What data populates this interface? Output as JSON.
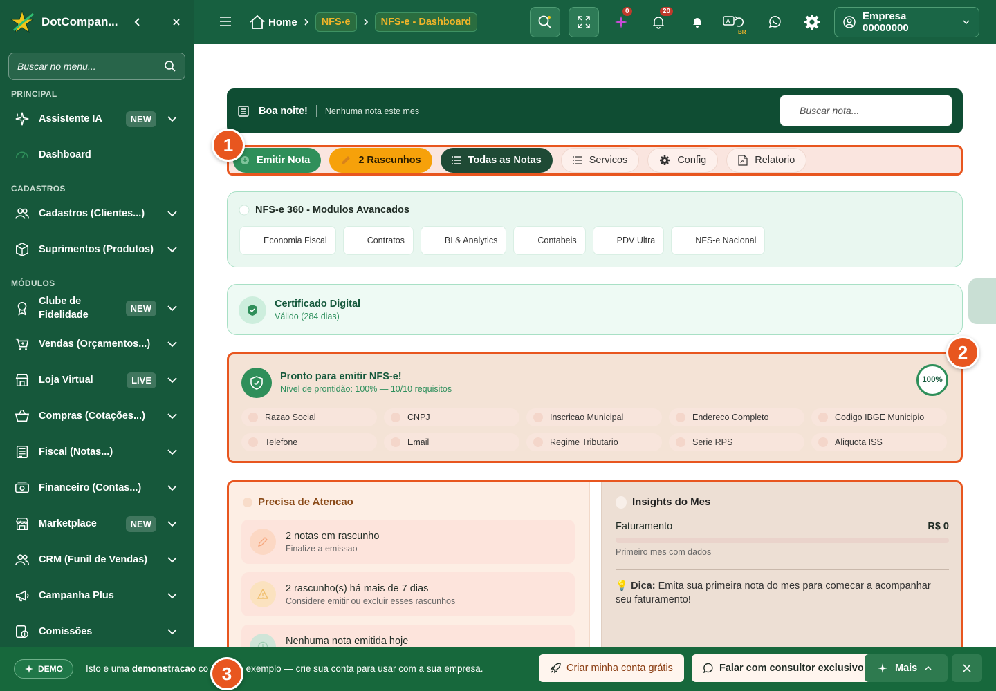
{
  "sidebar": {
    "brand": "DotCompan...",
    "search_placeholder": "Buscar no menu...",
    "sections": {
      "principal": "PRINCIPAL",
      "cadastros": "CADASTROS",
      "modulos": "MÓDULOS"
    },
    "items": [
      {
        "label": "Assistente IA",
        "badge": "NEW",
        "icon": "sparkle-icon"
      },
      {
        "label": "Dashboard",
        "badge": "",
        "icon": "gauge-icon"
      },
      {
        "label": "Cadastros (Clientes...)",
        "badge": "",
        "icon": "users-icon"
      },
      {
        "label": "Suprimentos (Produtos)",
        "badge": "",
        "icon": "box-icon"
      },
      {
        "label": "Clube de Fidelidade",
        "badge": "NEW",
        "icon": "medal-icon"
      },
      {
        "label": "Vendas (Orçamentos...)",
        "badge": "",
        "icon": "cart-icon"
      },
      {
        "label": "Loja Virtual",
        "badge": "LIVE",
        "icon": "store-icon"
      },
      {
        "label": "Compras (Cotações...)",
        "badge": "",
        "icon": "basket-icon"
      },
      {
        "label": "Fiscal (Notas...)",
        "badge": "",
        "icon": "receipt-icon"
      },
      {
        "label": "Financeiro (Contas...)",
        "badge": "",
        "icon": "money-icon"
      },
      {
        "label": "Marketplace",
        "badge": "NEW",
        "icon": "shop-icon"
      },
      {
        "label": "CRM (Funil de Vendas)",
        "badge": "",
        "icon": "users-icon"
      },
      {
        "label": "Campanha Plus",
        "badge": "",
        "icon": "megaphone-icon"
      },
      {
        "label": "Comissões",
        "badge": "",
        "icon": "coins-icon"
      }
    ]
  },
  "topbar": {
    "breadcrumb": {
      "home": "Home",
      "nfse": "NFS-e",
      "dashboard": "NFS-e - Dashboard"
    },
    "ai_count": "0",
    "notif_count": "20",
    "lang": "BR",
    "empresa": "Empresa 00000000"
  },
  "hero": {
    "greeting": "Boa noite!",
    "subtitle": "Nenhuma nota este mes",
    "search_placeholder": "Buscar nota..."
  },
  "actions": [
    {
      "label": "Emitir Nota",
      "style": "green"
    },
    {
      "label": "2 Rascunhos",
      "style": "orange"
    },
    {
      "label": "Todas as Notas",
      "style": "dark"
    },
    {
      "label": "Servicos",
      "style": "light"
    },
    {
      "label": "Config",
      "style": "light"
    },
    {
      "label": "Relatorio",
      "style": "light"
    }
  ],
  "modules": {
    "title": "NFS-e 360 - Modulos Avancados",
    "items": [
      "Economia Fiscal",
      "Contratos",
      "BI & Analytics",
      "Contabeis",
      "PDV Ultra",
      "NFS-e Nacional"
    ]
  },
  "certificate": {
    "title": "Certificado Digital",
    "status": "Válido (284 dias)"
  },
  "readiness": {
    "title": "Pronto para emitir NFS-e!",
    "subtitle": "Nível de prontidão: 100% — 10/10 requisitos",
    "percent_label": "100%",
    "percent": 100,
    "requirements": [
      "Razao Social",
      "CNPJ",
      "Inscricao Municipal",
      "Endereco Completo",
      "Codigo IBGE Municipio",
      "Telefone",
      "Email",
      "Regime Tributario",
      "Serie RPS",
      "Aliquota ISS"
    ]
  },
  "attention": {
    "title": "Precisa de Atencao",
    "items": [
      {
        "title": "2 notas em rascunho",
        "subtitle": "Finalize a emissao"
      },
      {
        "title": "2 rascunho(s) há mais de 7 dias",
        "subtitle": "Considere emitir ou excluir esses rascunhos"
      },
      {
        "title": "Nenhuma nota emitida hoje",
        "subtitle": ""
      }
    ]
  },
  "insights": {
    "title": "Insights do Mes",
    "revenue_label": "Faturamento",
    "revenue_value": "R$ 0",
    "revenue_progress": 0,
    "note": "Primeiro mes com dados",
    "tip_label": "Dica:",
    "tip_text": "Emita sua primeira nota do mes para comecar a acompanhar seu faturamento!"
  },
  "demo_bar": {
    "badge": "DEMO",
    "text_start": "Isto e uma ",
    "text_bold": "demonstracao",
    "text_mid": " co",
    "text_end": " de exemplo — crie sua conta para usar com a sua empresa.",
    "create_account": "Criar minha conta grátis",
    "consultant": "Falar com consultor exclusivo",
    "more": "Mais"
  },
  "markers": [
    "1",
    "2",
    "3"
  ]
}
